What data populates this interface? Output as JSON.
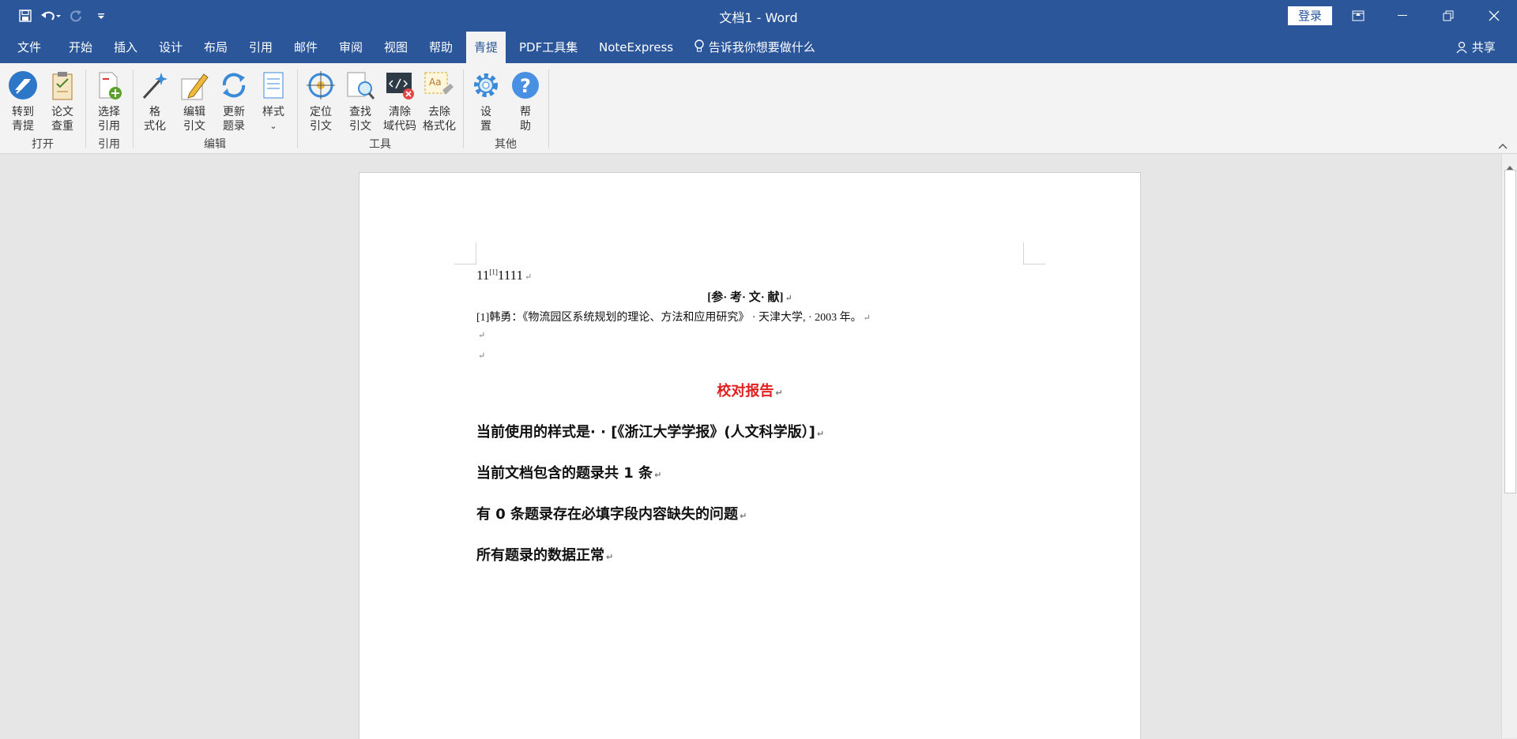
{
  "window": {
    "title": "文档1  -  Word",
    "login_label": "登录"
  },
  "tabs": [
    "文件",
    "开始",
    "插入",
    "设计",
    "布局",
    "引用",
    "邮件",
    "审阅",
    "视图",
    "帮助",
    "青提",
    "PDF工具集",
    "NoteExpress"
  ],
  "tell_me": "告诉我你想要做什么",
  "share": "共享",
  "ribbon": {
    "buttons": {
      "goto_qingti": [
        "转到",
        "青提"
      ],
      "paper_check": [
        "论文",
        "查重"
      ],
      "select_cite": [
        "选择",
        "引用"
      ],
      "format": [
        "格",
        "式化"
      ],
      "edit_cite": [
        "编辑",
        "引文"
      ],
      "update_records": [
        "更新",
        "题录"
      ],
      "style": [
        "样式",
        "⌄"
      ],
      "locate_cite": [
        "定位",
        "引文"
      ],
      "find_cite": [
        "查找",
        "引文"
      ],
      "clear_field": [
        "清除",
        "域代码"
      ],
      "remove_format": [
        "去除",
        "格式化"
      ],
      "settings": [
        "设",
        "置"
      ],
      "help": [
        "帮",
        "助"
      ]
    },
    "groups": {
      "open": "打开",
      "cite": "引用",
      "edit": "编辑",
      "tools": "工具",
      "other": "其他"
    }
  },
  "document": {
    "line1_pre": "11",
    "line1_sup": "[1]",
    "line1_post": "1111",
    "ref_heading": "[参· 考· 文· 献]",
    "ref_item": "[1]韩勇：《物流园区系统规划的理论、方法和应用研究》 · 天津大学, · 2003 年。",
    "report_title": "校对报告",
    "line_style": "当前使用的样式是· · [《浙江大学学报》(人文科学版）]",
    "line_count": "当前文档包含的题录共 1 条",
    "line_missing": "有 0 条题录存在必填字段内容缺失的问题",
    "line_ok": "所有题录的数据正常",
    "para_mark": "↵"
  },
  "colors": {
    "accent": "#2b579a",
    "report_red": "#e02020"
  }
}
